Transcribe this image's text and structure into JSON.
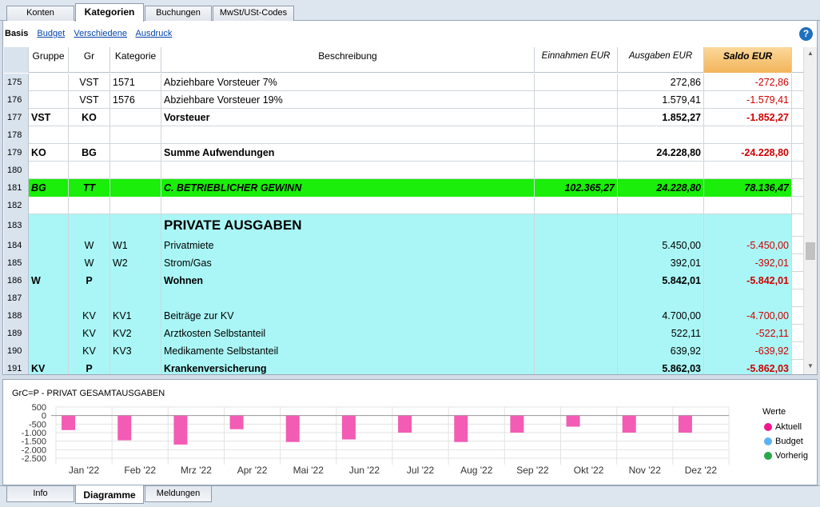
{
  "tabs": [
    "Konten",
    "Kategorien",
    "Buchungen",
    "MwSt/USt-Codes"
  ],
  "subnav": {
    "current": "Basis",
    "links": [
      "Budget",
      "Verschiedene",
      "Ausdruck"
    ]
  },
  "help_icon": "?",
  "columns": {
    "gruppe": "Gruppe",
    "gr": "Gr",
    "kategorie": "Kategorie",
    "beschreibung": "Beschreibung",
    "einnahmen": "Einnahmen EUR",
    "ausgaben": "Ausgaben EUR",
    "saldo": "Saldo EUR"
  },
  "rows": [
    {
      "n": "175",
      "gruppe": "",
      "gr": "VST",
      "kat": "1571",
      "desc": "Abziehbare Vorsteuer 7%",
      "ein": "",
      "aus": "272,86",
      "saldo": "-272,86",
      "style": "",
      "bg": "white"
    },
    {
      "n": "176",
      "gruppe": "",
      "gr": "VST",
      "kat": "1576",
      "desc": "Abziehbare Vorsteuer 19%",
      "ein": "",
      "aus": "1.579,41",
      "saldo": "-1.579,41",
      "style": "",
      "bg": "white"
    },
    {
      "n": "177",
      "gruppe": "VST",
      "gr": "KO",
      "kat": "",
      "desc": "Vorsteuer",
      "ein": "",
      "aus": "1.852,27",
      "saldo": "-1.852,27",
      "style": "b",
      "bg": "white"
    },
    {
      "n": "178",
      "gruppe": "",
      "gr": "",
      "kat": "",
      "desc": "",
      "ein": "",
      "aus": "",
      "saldo": "",
      "style": "",
      "bg": "white"
    },
    {
      "n": "179",
      "gruppe": "KO",
      "gr": "BG",
      "kat": "",
      "desc": "Summe Aufwendungen",
      "ein": "",
      "aus": "24.228,80",
      "saldo": "-24.228,80",
      "style": "b",
      "bg": "white"
    },
    {
      "n": "180",
      "gruppe": "",
      "gr": "",
      "kat": "",
      "desc": "",
      "ein": "",
      "aus": "",
      "saldo": "",
      "style": "",
      "bg": "white"
    },
    {
      "n": "181",
      "gruppe": "BG",
      "gr": "TT",
      "kat": "",
      "desc": "C. BETRIEBLICHER GEWINN",
      "ein": "102.365,27",
      "aus": "24.228,80",
      "saldo": "78.136,47",
      "style": "bi",
      "bg": "green"
    },
    {
      "n": "182",
      "gruppe": "",
      "gr": "",
      "kat": "",
      "desc": "",
      "ein": "",
      "aus": "",
      "saldo": "",
      "style": "",
      "bg": "white"
    },
    {
      "n": "183",
      "gruppe": "",
      "gr": "",
      "kat": "",
      "desc": "PRIVATE AUSGABEN",
      "ein": "",
      "aus": "",
      "saldo": "",
      "style": "title",
      "bg": "cyan"
    },
    {
      "n": "184",
      "gruppe": "",
      "gr": "W",
      "kat": "W1",
      "desc": "Privatmiete",
      "ein": "",
      "aus": "5.450,00",
      "saldo": "-5.450,00",
      "style": "",
      "bg": "cyan"
    },
    {
      "n": "185",
      "gruppe": "",
      "gr": "W",
      "kat": "W2",
      "desc": "Strom/Gas",
      "ein": "",
      "aus": "392,01",
      "saldo": "-392,01",
      "style": "",
      "bg": "cyan"
    },
    {
      "n": "186",
      "gruppe": "W",
      "gr": "P",
      "kat": "",
      "desc": "Wohnen",
      "ein": "",
      "aus": "5.842,01",
      "saldo": "-5.842,01",
      "style": "b",
      "bg": "cyan"
    },
    {
      "n": "187",
      "gruppe": "",
      "gr": "",
      "kat": "",
      "desc": "",
      "ein": "",
      "aus": "",
      "saldo": "",
      "style": "",
      "bg": "cyan"
    },
    {
      "n": "188",
      "gruppe": "",
      "gr": "KV",
      "kat": "KV1",
      "desc": "Beiträge zur KV",
      "ein": "",
      "aus": "4.700,00",
      "saldo": "-4.700,00",
      "style": "",
      "bg": "cyan"
    },
    {
      "n": "189",
      "gruppe": "",
      "gr": "KV",
      "kat": "KV2",
      "desc": "Arztkosten Selbstanteil",
      "ein": "",
      "aus": "522,11",
      "saldo": "-522,11",
      "style": "",
      "bg": "cyan"
    },
    {
      "n": "190",
      "gruppe": "",
      "gr": "KV",
      "kat": "KV3",
      "desc": "Medikamente Selbstanteil",
      "ein": "",
      "aus": "639,92",
      "saldo": "-639,92",
      "style": "",
      "bg": "cyan"
    },
    {
      "n": "191",
      "gruppe": "KV",
      "gr": "P",
      "kat": "",
      "desc": "Krankenversicherung",
      "ein": "",
      "aus": "5.862,03",
      "saldo": "-5.862,03",
      "style": "b",
      "bg": "cyan"
    }
  ],
  "chart_data": {
    "type": "bar",
    "title": "GrC=P - PRIVAT GESAMTAUSGABEN",
    "categories": [
      "Jan '22",
      "Feb '22",
      "Mrz '22",
      "Apr '22",
      "Mai '22",
      "Jun '22",
      "Jul '22",
      "Aug '22",
      "Sep '22",
      "Okt '22",
      "Nov '22",
      "Dez '22"
    ],
    "y_ticks": [
      "500",
      "0",
      "-500",
      "-1.000",
      "-1.500",
      "-2.000",
      "-2.500"
    ],
    "ylim": [
      -2500,
      500
    ],
    "legend_title": "Werte",
    "series": [
      {
        "name": "Aktuell",
        "color": "#f25cb4",
        "values": [
          -850,
          -1450,
          -1700,
          -800,
          -1550,
          -1400,
          -1000,
          -1550,
          -1000,
          -650,
          -1000,
          -1000
        ]
      },
      {
        "name": "Budget",
        "color": "#5cb3f2",
        "values": []
      },
      {
        "name": "Vorherig",
        "color": "#2aa84a",
        "values": []
      }
    ]
  },
  "bottom_tabs": [
    "Info",
    "Diagramme",
    "Meldungen"
  ]
}
